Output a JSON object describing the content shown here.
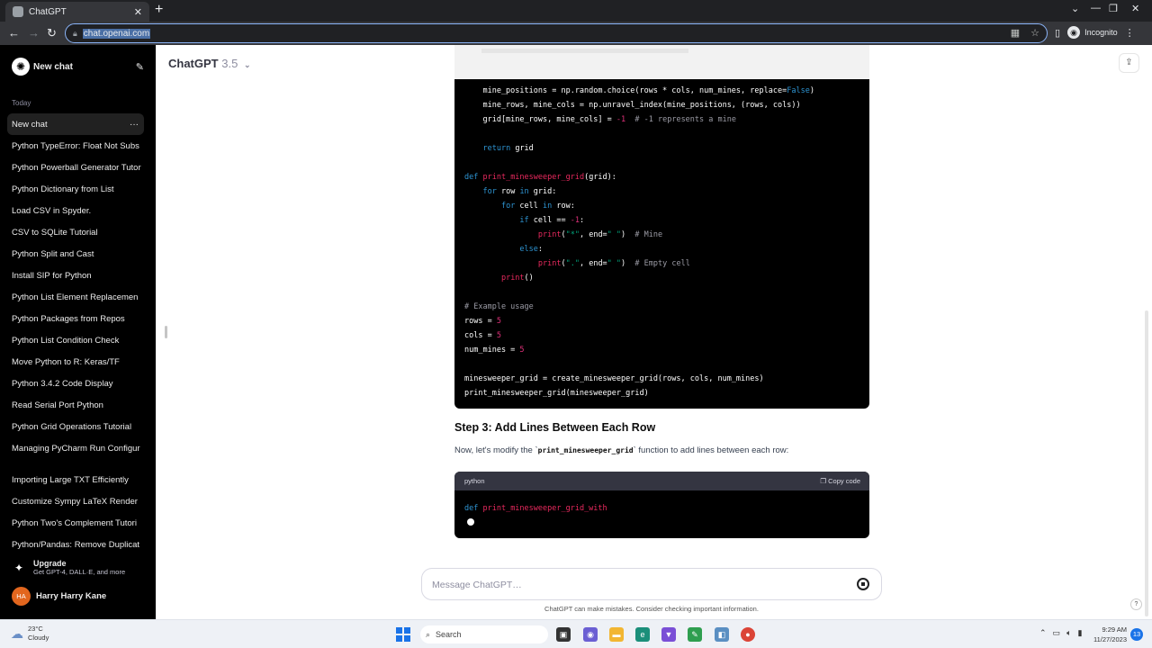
{
  "browser": {
    "tab_title": "ChatGPT",
    "tab_close": "✕",
    "new_tab": "+",
    "url": "chat.openai.com",
    "incognito_label": "Incognito"
  },
  "sidebar": {
    "new_chat": "New chat",
    "section_today": "Today",
    "items": [
      {
        "label": "New chat"
      },
      {
        "label": "Python TypeError: Float Not Subs"
      },
      {
        "label": "Python Powerball Generator Tutor"
      },
      {
        "label": "Python Dictionary from List"
      },
      {
        "label": "Load CSV in Spyder."
      },
      {
        "label": "CSV to SQLite Tutorial"
      },
      {
        "label": "Python Split and Cast"
      },
      {
        "label": "Install SIP for Python"
      },
      {
        "label": "Python List Element Replacemen"
      },
      {
        "label": "Python Packages from Repos"
      },
      {
        "label": "Python List Condition Check"
      },
      {
        "label": "Move Python to R: Keras/TF"
      },
      {
        "label": "Python 3.4.2 Code Display"
      },
      {
        "label": "Read Serial Port Python"
      },
      {
        "label": "Python Grid Operations Tutorial"
      },
      {
        "label": "Managing PyCharm Run Configur"
      }
    ],
    "items_later": [
      {
        "label": "Importing Large TXT Efficiently"
      },
      {
        "label": "Customize Sympy LaTeX Render"
      },
      {
        "label": "Python Two's Complement Tutori"
      },
      {
        "label": "Python/Pandas: Remove Duplicat"
      }
    ],
    "upgrade_title": "Upgrade",
    "upgrade_sub": "Get GPT-4, DALL·E, and more",
    "user_initials": "HA",
    "user_name": "Harry Harry Kane"
  },
  "main": {
    "model_name": "ChatGPT",
    "model_version": "3.5",
    "step_heading": "Step 3: Add Lines Between Each Row",
    "para_before": "Now, let's modify the `",
    "para_code": "print_minesweeper_grid",
    "para_after": "` function to add lines between each row:",
    "code2_lang": "python",
    "code2_copy": "Copy code",
    "composer_placeholder": "Message ChatGPT…",
    "disclaimer": "ChatGPT can make mistakes. Consider checking important information.",
    "help": "?"
  },
  "taskbar": {
    "temp": "23°C",
    "condition": "Cloudy",
    "search": "Search",
    "time": "9:29 AM",
    "date": "11/27/2023",
    "notif_count": "13"
  },
  "colors": {
    "keyword": "#2e95d3",
    "function": "#e9295e",
    "string": "#00a67d",
    "number": "#df3079",
    "comment": "#9b9ba5",
    "avatar": "#e2661e"
  }
}
